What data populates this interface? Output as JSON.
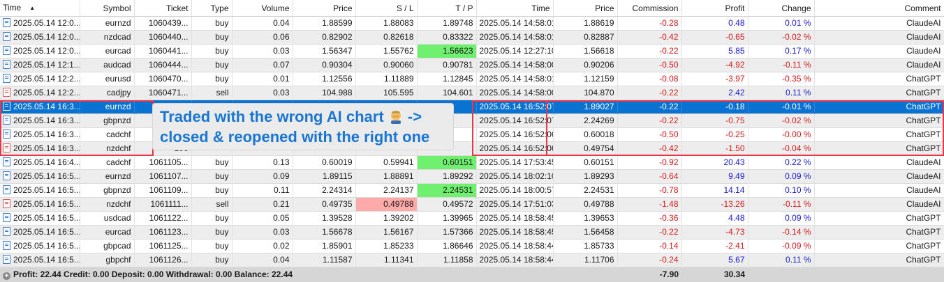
{
  "columns": [
    "Time",
    "Symbol",
    "Ticket",
    "Type",
    "Volume",
    "Price",
    "S / L",
    "T / P",
    "Time",
    "Price",
    "Commission",
    "Profit",
    "Change",
    "Comment"
  ],
  "rows": [
    {
      "open_time": "2025.05.14 12:0...",
      "symbol": "eurnzd",
      "ticket": "1060439...",
      "type": "buy",
      "volume": "0.04",
      "price": "1.88599",
      "sl": "1.88083",
      "tp": "1.89748",
      "close_time": "2025.05.14 14:58:01",
      "close_price": "1.88619",
      "commission": "-0.28",
      "profit": "0.48",
      "change": "0.01 %",
      "comment": "ClaudeAI"
    },
    {
      "open_time": "2025.05.14 12:0...",
      "symbol": "nzdcad",
      "ticket": "1060440...",
      "type": "buy",
      "volume": "0.06",
      "price": "0.82902",
      "sl": "0.82618",
      "tp": "0.83322",
      "close_time": "2025.05.14 14:58:01",
      "close_price": "0.82887",
      "commission": "-0.42",
      "profit": "-0.65",
      "change": "-0.02 %",
      "comment": "ClaudeAI"
    },
    {
      "open_time": "2025.05.14 12:0...",
      "symbol": "eurcad",
      "ticket": "1060441...",
      "type": "buy",
      "volume": "0.03",
      "price": "1.56347",
      "sl": "1.55762",
      "tp": "1.56623",
      "close_time": "2025.05.14 12:27:10",
      "close_price": "1.56618",
      "commission": "-0.22",
      "profit": "5.85",
      "change": "0.17 %",
      "comment": "ClaudeAI"
    },
    {
      "open_time": "2025.05.14 12:1...",
      "symbol": "audcad",
      "ticket": "1060444...",
      "type": "buy",
      "volume": "0.07",
      "price": "0.90304",
      "sl": "0.90060",
      "tp": "0.90781",
      "close_time": "2025.05.14 14:58:00",
      "close_price": "0.90206",
      "commission": "-0.50",
      "profit": "-4.92",
      "change": "-0.11 %",
      "comment": "ClaudeAI"
    },
    {
      "open_time": "2025.05.14 12:2...",
      "symbol": "eurusd",
      "ticket": "1060470...",
      "type": "buy",
      "volume": "0.01",
      "price": "1.12556",
      "sl": "1.11889",
      "tp": "1.12845",
      "close_time": "2025.05.14 14:58:01",
      "close_price": "1.12159",
      "commission": "-0.08",
      "profit": "-3.97",
      "change": "-0.35 %",
      "comment": "ChatGPT"
    },
    {
      "open_time": "2025.05.14 12:2...",
      "symbol": "cadjpy",
      "ticket": "1060471...",
      "type": "sell",
      "volume": "0.03",
      "price": "104.988",
      "sl": "105.595",
      "tp": "104.601",
      "close_time": "2025.05.14 14:58:00",
      "close_price": "104.870",
      "commission": "-0.22",
      "profit": "2.42",
      "change": "0.11 %",
      "comment": "ChatGPT"
    },
    {
      "open_time": "2025.05.14 16:3...",
      "symbol": "eurnzd",
      "ticket": "106",
      "type": "",
      "volume": "",
      "price": "",
      "sl": "",
      "tp": "",
      "close_time": "2025.05.14 16:52:07",
      "close_price": "1.89027",
      "commission": "-0.22",
      "profit": "-0.18",
      "change": "-0.01 %",
      "comment": "ChatGPT"
    },
    {
      "open_time": "2025.05.14 16:3...",
      "symbol": "gbpnzd",
      "ticket": "106",
      "type": "",
      "volume": "",
      "price": "",
      "sl": "",
      "tp": "",
      "close_time": "2025.05.14 16:52:07",
      "close_price": "2.24269",
      "commission": "-0.22",
      "profit": "-0.75",
      "change": "-0.02 %",
      "comment": "ChatGPT"
    },
    {
      "open_time": "2025.05.14 16:3...",
      "symbol": "cadchf",
      "ticket": "106",
      "type": "",
      "volume": "",
      "price": "",
      "sl": "",
      "tp": "",
      "close_time": "2025.05.14 16:52:06",
      "close_price": "0.60018",
      "commission": "-0.50",
      "profit": "-0.25",
      "change": "-0.00 %",
      "comment": "ChatGPT"
    },
    {
      "open_time": "2025.05.14 16:3...",
      "symbol": "nzdchf",
      "ticket": "106",
      "type": "",
      "volume": "",
      "price": "",
      "sl": "",
      "tp": "",
      "close_time": "2025.05.14 16:52:06",
      "close_price": "0.49754",
      "commission": "-0.42",
      "profit": "-1.50",
      "change": "-0.04 %",
      "comment": "ChatGPT"
    },
    {
      "open_time": "2025.05.14 16:4...",
      "symbol": "cadchf",
      "ticket": "1061105...",
      "type": "buy",
      "volume": "0.13",
      "price": "0.60019",
      "sl": "0.59941",
      "tp": "0.60151",
      "close_time": "2025.05.14 17:53:45",
      "close_price": "0.60151",
      "commission": "-0.92",
      "profit": "20.43",
      "change": "0.22 %",
      "comment": "ClaudeAI"
    },
    {
      "open_time": "2025.05.14 16:5...",
      "symbol": "eurnzd",
      "ticket": "1061107...",
      "type": "buy",
      "volume": "0.09",
      "price": "1.89115",
      "sl": "1.88891",
      "tp": "1.89292",
      "close_time": "2025.05.14 18:02:10",
      "close_price": "1.89293",
      "commission": "-0.64",
      "profit": "9.49",
      "change": "0.09 %",
      "comment": "ClaudeAI"
    },
    {
      "open_time": "2025.05.14 16:5...",
      "symbol": "gbpnzd",
      "ticket": "1061109...",
      "type": "buy",
      "volume": "0.11",
      "price": "2.24314",
      "sl": "2.24137",
      "tp": "2.24531",
      "close_time": "2025.05.14 18:00:57",
      "close_price": "2.24531",
      "commission": "-0.78",
      "profit": "14.14",
      "change": "0.10 %",
      "comment": "ClaudeAI"
    },
    {
      "open_time": "2025.05.14 16:5...",
      "symbol": "nzdchf",
      "ticket": "1061111...",
      "type": "sell",
      "volume": "0.21",
      "price": "0.49735",
      "sl": "0.49788",
      "tp": "0.49572",
      "close_time": "2025.05.14 17:51:03",
      "close_price": "0.49788",
      "commission": "-1.48",
      "profit": "-13.26",
      "change": "-0.11 %",
      "comment": "ClaudeAI"
    },
    {
      "open_time": "2025.05.14 16:5...",
      "symbol": "usdcad",
      "ticket": "1061122...",
      "type": "buy",
      "volume": "0.05",
      "price": "1.39528",
      "sl": "1.39202",
      "tp": "1.39965",
      "close_time": "2025.05.14 18:58:45",
      "close_price": "1.39653",
      "commission": "-0.36",
      "profit": "4.48",
      "change": "0.09 %",
      "comment": "ChatGPT"
    },
    {
      "open_time": "2025.05.14 16:5...",
      "symbol": "eurcad",
      "ticket": "1061123...",
      "type": "buy",
      "volume": "0.03",
      "price": "1.56678",
      "sl": "1.56167",
      "tp": "1.57366",
      "close_time": "2025.05.14 18:58:45",
      "close_price": "1.56458",
      "commission": "-0.22",
      "profit": "-4.73",
      "change": "-0.14 %",
      "comment": "ChatGPT"
    },
    {
      "open_time": "2025.05.14 16:5...",
      "symbol": "gbpcad",
      "ticket": "1061125...",
      "type": "buy",
      "volume": "0.02",
      "price": "1.85901",
      "sl": "1.85233",
      "tp": "1.86646",
      "close_time": "2025.05.14 18:58:44",
      "close_price": "1.85733",
      "commission": "-0.14",
      "profit": "-2.41",
      "change": "-0.09 %",
      "comment": "ChatGPT"
    },
    {
      "open_time": "2025.05.14 16:5...",
      "symbol": "gbpchf",
      "ticket": "1061126...",
      "type": "buy",
      "volume": "0.04",
      "price": "1.11587",
      "sl": "1.11341",
      "tp": "1.11858",
      "close_time": "2025.05.14 18:58:44",
      "close_price": "1.11706",
      "commission": "-0.24",
      "profit": "5.67",
      "change": "0.11 %",
      "comment": "ChatGPT"
    }
  ],
  "summary": {
    "text": "Profit: 22.44  Credit: 0.00  Deposit: 0.00  Withdrawal: 0.00  Balance: 22.44",
    "commission_total": "-7.90",
    "profit_total": "30.34"
  },
  "annotation": {
    "line1": "Traded with the wrong AI chart",
    "arrow": "->",
    "line2": "closed & reopened with the right one",
    "icon": "facepalm-emoji-icon"
  },
  "colors": {
    "selection": "#0a72d0",
    "negative": "#d61a1a",
    "positive": "#1a1ad0",
    "tp_hit": "#6ff06f",
    "sl_hit": "#ffaaaa",
    "highlight_box": "#e8374a",
    "annotation_text": "#1976d2"
  }
}
